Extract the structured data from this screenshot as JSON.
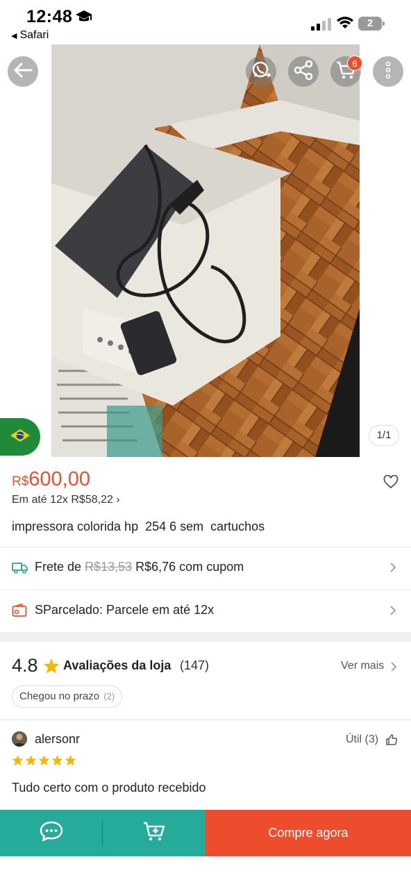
{
  "status_bar": {
    "time": "12:48",
    "back_app": "Safari",
    "battery": "2"
  },
  "photo": {
    "page_indicator": "1/1",
    "cart_count": "6"
  },
  "product": {
    "currency": "R$",
    "price": "600,00",
    "installments": "Em até 12x R$58,22",
    "title": "impressora colorida hp  254 6 sem  cartuchos"
  },
  "shipping": {
    "prefix": "Frete de",
    "old_price": "R$13,53",
    "new_price": "R$6,76 com cupom"
  },
  "installment_row": {
    "label": "SParcelado: Parcele em até 12x"
  },
  "store_rating": {
    "score": "4.8",
    "label": "Avaliações da loja",
    "count": "(147)",
    "see_more": "Ver mais",
    "tag_label": "Chegou no prazo",
    "tag_count": "(2)"
  },
  "review": {
    "user": "alersonr",
    "useful": "Útil (3)",
    "rating": 5,
    "text": "Tudo certo com o produto recebido"
  },
  "bottom_bar": {
    "buy_label": "Compre agora"
  },
  "colors": {
    "accent": "#ee4d2d",
    "teal": "#26aa99",
    "star": "#f5b800"
  }
}
